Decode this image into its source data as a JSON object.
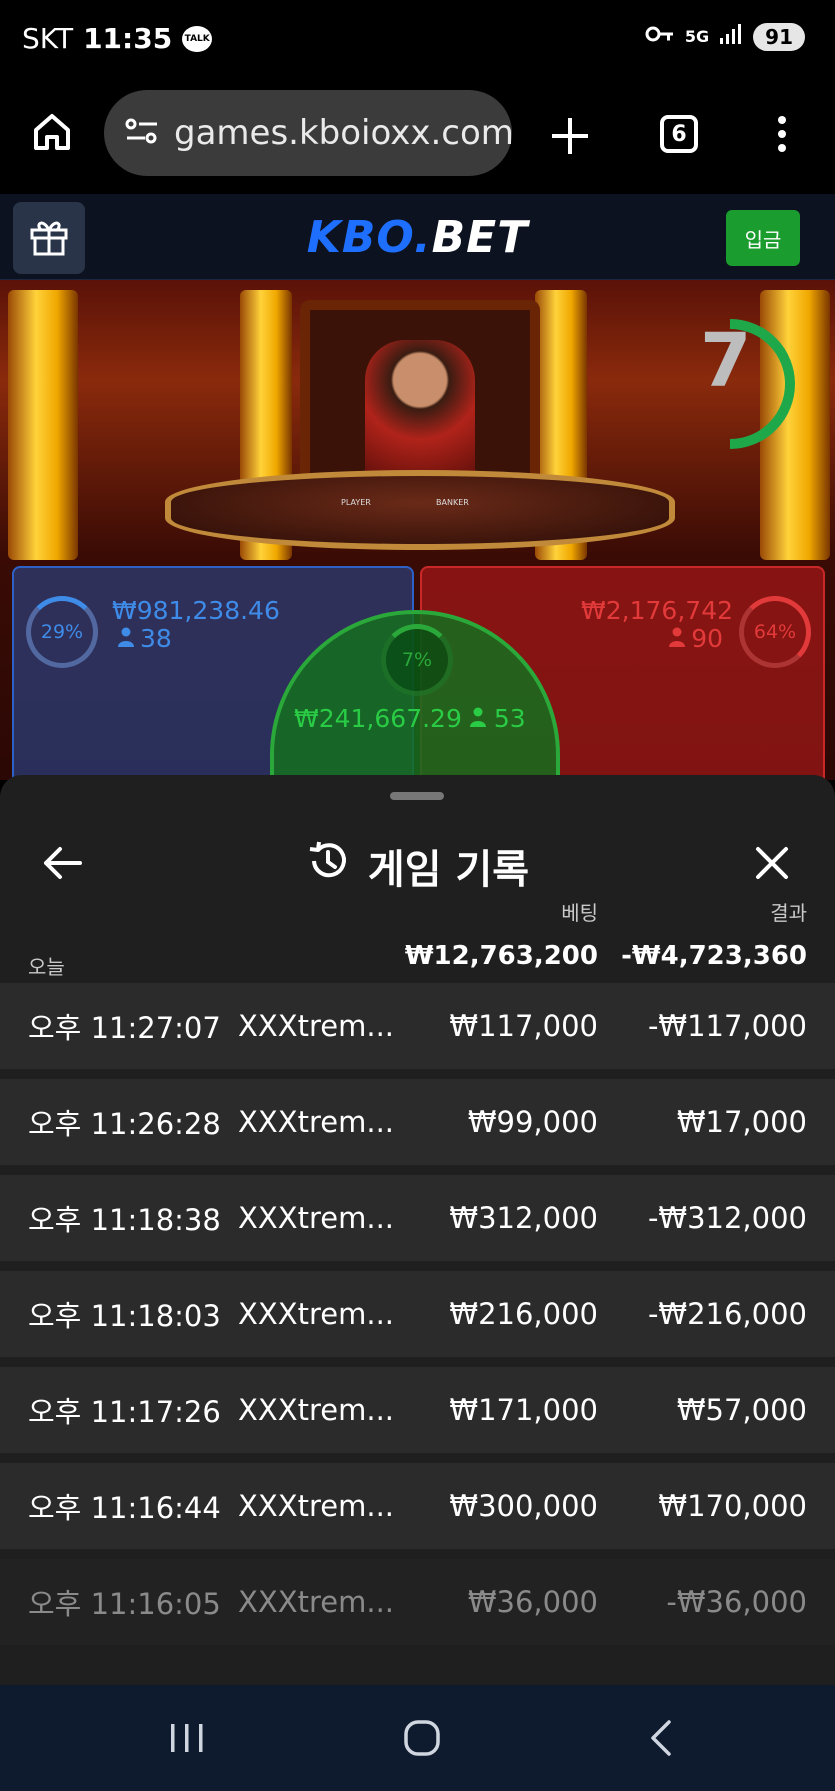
{
  "status_bar": {
    "carrier": "SKT",
    "time": "11:35",
    "talk_badge": "TALK",
    "network": "5G",
    "battery": "91"
  },
  "browser": {
    "url": "games.kboioxx.com/",
    "tab_count": "6"
  },
  "app_header": {
    "logo_part1": "KBO.",
    "logo_part2": "BET",
    "deposit_label": "입금"
  },
  "game": {
    "countdown": "7",
    "player": {
      "percent": "29%",
      "amount": "₩981,238.46",
      "bettors": "38"
    },
    "banker": {
      "percent": "64%",
      "amount": "₩2,176,742",
      "bettors": "90"
    },
    "tie": {
      "percent": "7%",
      "amount": "₩241,667.29",
      "bettors": "53"
    },
    "table_labels": {
      "player": "PLAYER",
      "banker": "BANKER"
    }
  },
  "history": {
    "title": "게임 기록",
    "col_bet": "베팅",
    "col_result": "결과",
    "today_label": "오늘",
    "today_bet": "₩12,763,200",
    "today_result": "-₩4,723,360",
    "rows": [
      {
        "time": "오후 11:27:07",
        "game": "XXXtrem...",
        "bet": "₩117,000",
        "result": "-₩117,000"
      },
      {
        "time": "오후 11:26:28",
        "game": "XXXtrem...",
        "bet": "₩99,000",
        "result": "₩17,000"
      },
      {
        "time": "오후 11:18:38",
        "game": "XXXtrem...",
        "bet": "₩312,000",
        "result": "-₩312,000"
      },
      {
        "time": "오후 11:18:03",
        "game": "XXXtrem...",
        "bet": "₩216,000",
        "result": "-₩216,000"
      },
      {
        "time": "오후 11:17:26",
        "game": "XXXtrem...",
        "bet": "₩171,000",
        "result": "₩57,000"
      },
      {
        "time": "오후 11:16:44",
        "game": "XXXtrem...",
        "bet": "₩300,000",
        "result": "₩170,000"
      },
      {
        "time": "오후 11:16:05",
        "game": "XXXtrem...",
        "bet": "₩36,000",
        "result": "-₩36,000"
      }
    ]
  },
  "colors": {
    "player_blue": "#2c62c8",
    "banker_red": "#c82828",
    "tie_green": "#2aa83a",
    "deposit_green": "#1a9c2e",
    "logo_blue": "#1f6fff"
  }
}
